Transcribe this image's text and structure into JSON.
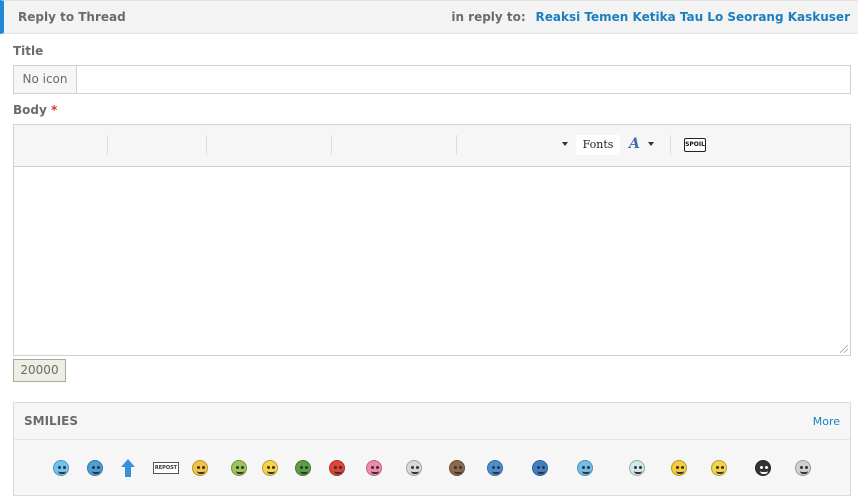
{
  "header": {
    "title": "Reply to Thread",
    "in_reply_label": "in reply to:",
    "thread_link": "Reaksi Temen Ketika Tau Lo Seorang Kaskuser"
  },
  "form": {
    "title_label": "Title",
    "icon_button": "No icon",
    "title_value": "",
    "body_label": "Body",
    "required_mark": "*",
    "body_value": "",
    "char_counter": "20000"
  },
  "toolbar": {
    "fonts_label": "Fonts",
    "font_color_glyph": "A",
    "spoiler_label": "SPOIL"
  },
  "smilies": {
    "title": "SMILIES",
    "more_label": "More",
    "items": [
      {
        "icon": "blue-grin-smiley-icon",
        "color": "#6ec6f0"
      },
      {
        "icon": "blue-shocked-smiley-icon",
        "color": "#4a9fd8"
      },
      {
        "icon": "up-arrow-icon",
        "color": "#3b8fe0"
      },
      {
        "icon": "repost-sign-icon",
        "color": "#ffffff",
        "text": "REPOST"
      },
      {
        "icon": "laughing-smiley-icon",
        "color": "#f4c542"
      },
      {
        "icon": "sick-smiley-icon",
        "color": "#9bc45a"
      },
      {
        "icon": "confused-smiley-icon",
        "color": "#f5d547"
      },
      {
        "icon": "cendol-smiley-icon",
        "color": "#5aa043"
      },
      {
        "icon": "angry-smiley-icon",
        "color": "#e0443a"
      },
      {
        "icon": "hearts-smiley-icon",
        "color": "#f08aa8"
      },
      {
        "icon": "grey-peace-smiley-icon",
        "color": "#d8d8d8"
      },
      {
        "icon": "cowboy-smiley-icon",
        "color": "#8a6a4a"
      },
      {
        "icon": "blue-hug-smiley-icon",
        "color": "#4a8fd0"
      },
      {
        "icon": "blue-kiss-smiley-icon",
        "color": "#3f7fc8"
      },
      {
        "icon": "group-smiley-icon",
        "color": "#6fc0e8"
      },
      {
        "icon": "grey-blush-smiley-icon",
        "color": "#cfe6ea"
      },
      {
        "icon": "surprised-smiley-icon",
        "color": "#f5cc3a"
      },
      {
        "icon": "blank-smiley-icon",
        "color": "#f5d547"
      },
      {
        "icon": "bomb-smiley-icon",
        "color": "#333333"
      },
      {
        "icon": "sign-smiley-icon",
        "color": "#cfcfcf"
      }
    ]
  }
}
